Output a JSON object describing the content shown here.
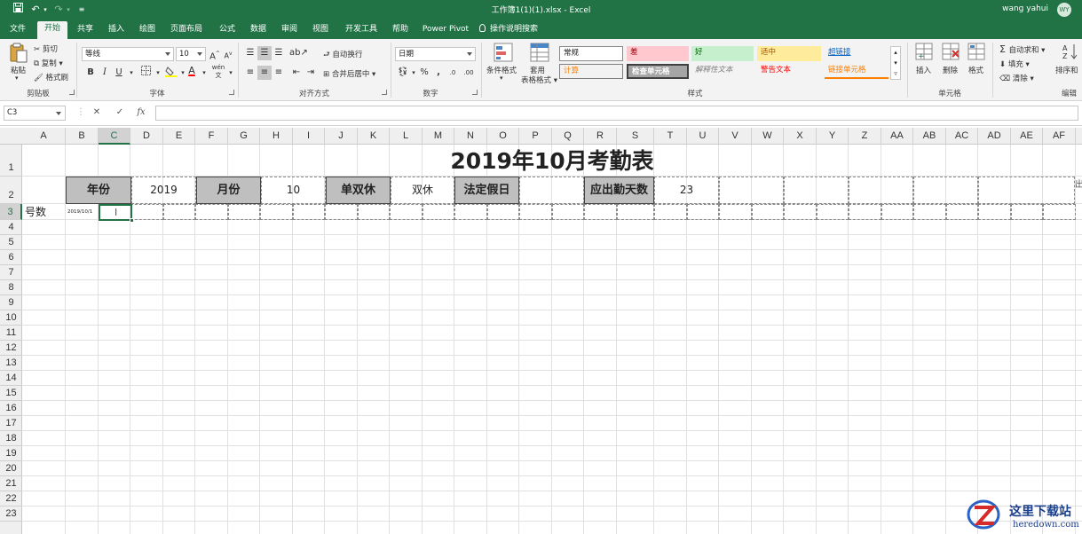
{
  "window": {
    "title": "工作簿1(1)(1).xlsx - Excel",
    "user": "wang yahui",
    "avatar": "WY"
  },
  "quick_access": {
    "save_icon": "save-icon",
    "undo_icon": "undo-icon",
    "redo_icon": "redo-icon",
    "customize_icon": "customize-icon"
  },
  "tabs": [
    "文件",
    "开始",
    "共享",
    "插入",
    "绘图",
    "页面布局",
    "公式",
    "数据",
    "审阅",
    "视图",
    "开发工具",
    "帮助",
    "Power Pivot",
    "操作说明搜索"
  ],
  "active_tab": "开始",
  "ribbon": {
    "clipboard": {
      "paste": "粘贴",
      "cut": "剪切",
      "copy": "复制",
      "format_painter": "格式刷",
      "label": "剪贴板"
    },
    "font": {
      "name": "等线",
      "size": "10",
      "bold": "B",
      "italic": "I",
      "underline": "U",
      "grow": "A",
      "shrink": "A",
      "wen": "wén",
      "color_a": "A",
      "label": "字体"
    },
    "alignment": {
      "wrap": "自动换行",
      "merge": "合并后居中",
      "label": "对齐方式"
    },
    "number": {
      "format": "日期",
      "percent": "%",
      "comma": ",",
      "inc_dec": ".0",
      "dec_dec": ".00",
      "label": "数字"
    },
    "styles": {
      "conditional": "条件格式",
      "table": "套用\n表格格式",
      "table_line1": "套用",
      "table_line2": "表格格式",
      "items": [
        "常规",
        "差",
        "好",
        "适中",
        "超链接",
        "计算",
        "检查单元格",
        "解释性文本",
        "警告文本",
        "链接单元格"
      ],
      "label": "样式"
    },
    "cells": {
      "insert": "插入",
      "delete": "删除",
      "format": "格式",
      "label": "单元格"
    },
    "editing": {
      "autosum": "自动求和",
      "fill": "填充",
      "clear": "清除",
      "sort": "排序和",
      "label": "编辑"
    },
    "colors": {
      "bad_bg": "#ffc7ce",
      "bad_fg": "#9c0006",
      "good_bg": "#c6efce",
      "good_fg": "#006100",
      "neutral_bg": "#ffeb9c",
      "neutral_fg": "#9c5700",
      "hyperlink_fg": "#0563c1",
      "calc_bg": "#f2f2f2",
      "calc_fg": "#fa7d00",
      "check_bg": "#a5a5a5",
      "warn_fg": "#ff0000",
      "linked_fg": "#fa7d00"
    }
  },
  "formula_bar": {
    "name_box": "C3",
    "cancel": "✕",
    "enter": "✓",
    "fx": "fx",
    "value": ""
  },
  "columns": [
    "A",
    "B",
    "C",
    "D",
    "E",
    "F",
    "G",
    "H",
    "I",
    "J",
    "K",
    "L",
    "M",
    "N",
    "O",
    "P",
    "Q",
    "R",
    "S",
    "T",
    "U",
    "V",
    "W",
    "X",
    "Y",
    "Z",
    "AA",
    "AB",
    "AC",
    "AD",
    "AE",
    "AF"
  ],
  "rows": [
    "1",
    "2",
    "3",
    "4",
    "5",
    "6",
    "7",
    "8",
    "9",
    "10",
    "11",
    "12",
    "13",
    "14",
    "15",
    "16",
    "17",
    "18",
    "19",
    "20",
    "21",
    "22",
    "23"
  ],
  "sheet": {
    "title": "2019年10月考勤表",
    "year_label": "年份",
    "year_value": "2019",
    "month_label": "月份",
    "month_value": "10",
    "rest_label": "单双休",
    "rest_value": "双休",
    "holiday_label": "法定假日",
    "holiday_value": "",
    "workdays_label": "应出勤天数",
    "workdays_value": "23",
    "a3": "号数",
    "b3": "2019/10/1",
    "right_edge_text": "出"
  },
  "selected_cell": "C3",
  "watermark": {
    "line1": "这里下载站",
    "line2": "heredown.com"
  }
}
